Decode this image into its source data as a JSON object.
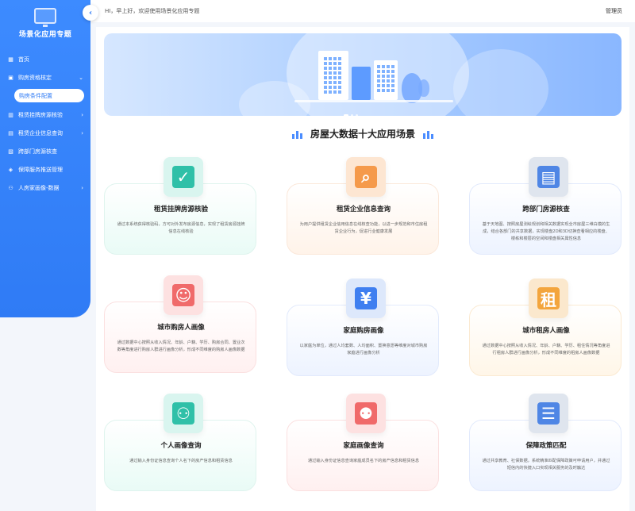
{
  "sidebar": {
    "title": "场景化应用专题",
    "items": [
      {
        "label": "首页",
        "icon": "home-icon",
        "arrow": false
      },
      {
        "label": "购房资格核定",
        "icon": "user-card-icon",
        "arrow": true,
        "expanded": true
      },
      {
        "label": "租赁挂牌房源核验",
        "icon": "building-icon",
        "arrow": true
      },
      {
        "label": "租赁企业信息查询",
        "icon": "briefcase-icon",
        "arrow": true
      },
      {
        "label": "跨部门房源核查",
        "icon": "search-doc-icon",
        "arrow": false
      },
      {
        "label": "保障服务推送管理",
        "icon": "shield-icon",
        "arrow": false
      },
      {
        "label": "人房家画像-数据",
        "icon": "people-icon",
        "arrow": true
      }
    ],
    "sub_item": "购房条件配置"
  },
  "header": {
    "greeting": "HI，早上好，欢迎使用场景化应用专题",
    "user": "管理员"
  },
  "main": {
    "section_title": "房屋大数据十大应用场景",
    "cards": [
      {
        "name": "租赁挂牌房源核验",
        "desc": "通过本系统获得核验码，方可对外发布房源信息，实现了租赁房源挂牌信息在线核验",
        "theme": "teal",
        "icon": "building-check-icon",
        "glyph": "✓"
      },
      {
        "name": "租赁企业信息查询",
        "desc": "为用户提供租赁企业信用信息在线核查功能，以进一步规范和市住房租赁企业行为，促进行业健康发展",
        "theme": "orange",
        "icon": "company-search-icon",
        "glyph": "⌕"
      },
      {
        "name": "跨部门房源核查",
        "desc": "基于天地图、按照房屋测绘规划和相关数据实现全市房屋三维白模的生成，结合各部门的共享数据，实现楼盘2D和3D切换查看相应的楼盘、楼栋和楼层的空间和楼盘相关属性信息",
        "theme": "blue",
        "icon": "document-search-icon",
        "glyph": "▤"
      },
      {
        "name": "城市购房人画像",
        "desc": "通过数据中心按照从收入情况、年龄、户籍、学历、购房合同、置业次数等角度进行购房人群进行画像分析，形成不同维度的购房人画像数据",
        "theme": "red",
        "icon": "buyer-portrait-icon",
        "glyph": "☺"
      },
      {
        "name": "家庭购房画像",
        "desc": "以家庭为单位，通过人均套数、人均面积、置换意愿等维度对城市购房家庭进行画像分析",
        "theme": "blue",
        "icon": "family-house-icon",
        "glyph": "¥"
      },
      {
        "name": "城市租房人画像",
        "desc": "通过数据中心按照从收入情况、年龄、户籍、学历、租住情况等角度进行租房人群进行画像分析，形成不同维度的租房人画像数据",
        "theme": "yellow",
        "icon": "rent-house-icon",
        "glyph": "租"
      },
      {
        "name": "个人画像查询",
        "desc": "通过输入身份证信息查询个人名下的房产信息和租赁信息",
        "theme": "teal",
        "icon": "person-scan-icon",
        "glyph": "⚇"
      },
      {
        "name": "家庭画像查询",
        "desc": "通过输入身份证信息查询家庭成员名下的房产信息和租赁信息",
        "theme": "red",
        "icon": "family-scan-icon",
        "glyph": "⚉"
      },
      {
        "name": "保障政策匹配",
        "desc": "通过共享教育、社保数据，系统精准匹配保障政策可申请用户，并通过短信内的快捷入口实现相关服务的及时触达",
        "theme": "slate",
        "icon": "policy-document-icon",
        "glyph": "☰"
      }
    ]
  }
}
